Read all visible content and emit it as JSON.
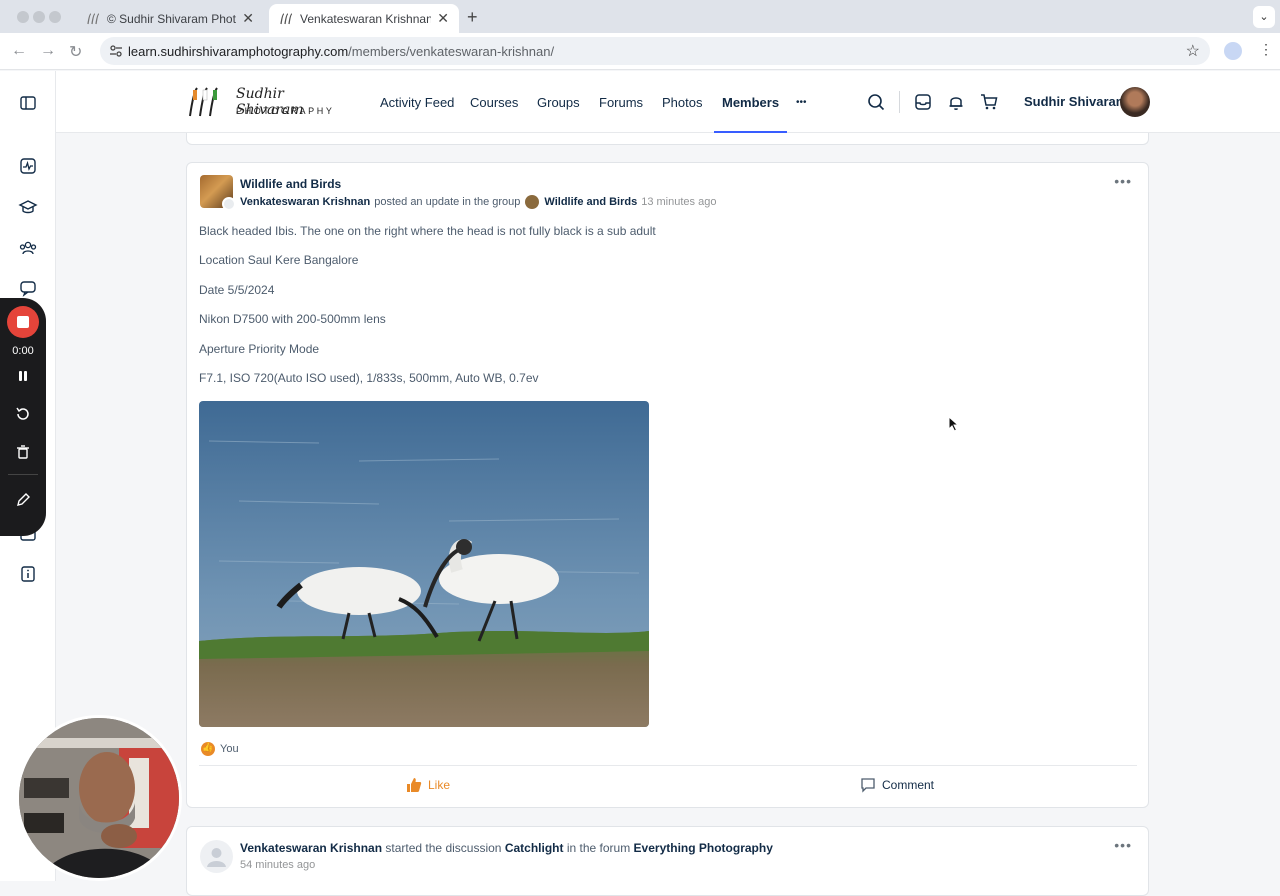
{
  "browser": {
    "tabs": [
      {
        "title": "© Sudhir Shivaram Photograp",
        "active": false
      },
      {
        "title": "Venkateswaran Krishnan – ©",
        "active": true
      }
    ],
    "url_host": "learn.sudhirshivaramphotography.com",
    "url_path": "/members/venkateswaran-krishnan/"
  },
  "recorder": {
    "time": "0:00"
  },
  "site": {
    "logo_script": "Sudhir Shivaram",
    "logo_word": "PHOTOGRAPHY",
    "menu": [
      "Activity Feed",
      "Courses",
      "Groups",
      "Forums",
      "Photos",
      "Members",
      "•••"
    ],
    "active_menu": "Members",
    "user_name": "Sudhir Shivaram"
  },
  "post": {
    "group_title": "Wildlife and Birds",
    "author": "Venkateswaran Krishnan",
    "action_text": "posted an update in the group",
    "group_name": "Wildlife and Birds",
    "time": "13 minutes ago",
    "lines": [
      "Black headed Ibis. The one on the right where the head is not fully black is a sub adult",
      "Location Saul Kere Bangalore",
      "Date 5/5/2024",
      "Nikon D7500 with 200-500mm lens",
      "Aperture Priority Mode",
      "F7.1, ISO 720(Auto ISO used), 1/833s, 500mm, Auto WB, 0.7ev"
    ],
    "reacted_by": "You",
    "like_label": "Like",
    "comment_label": "Comment",
    "more": "•••"
  },
  "discussion": {
    "author": "Venkateswaran Krishnan",
    "verb": "started the discussion",
    "topic": "Catchlight",
    "forum_prefix": "in the forum",
    "forum": "Everything Photography",
    "time": "54 minutes ago",
    "more": "•••"
  },
  "colors": {
    "accent": "#385dff",
    "like": "#e98a28",
    "record": "#e5443a"
  }
}
